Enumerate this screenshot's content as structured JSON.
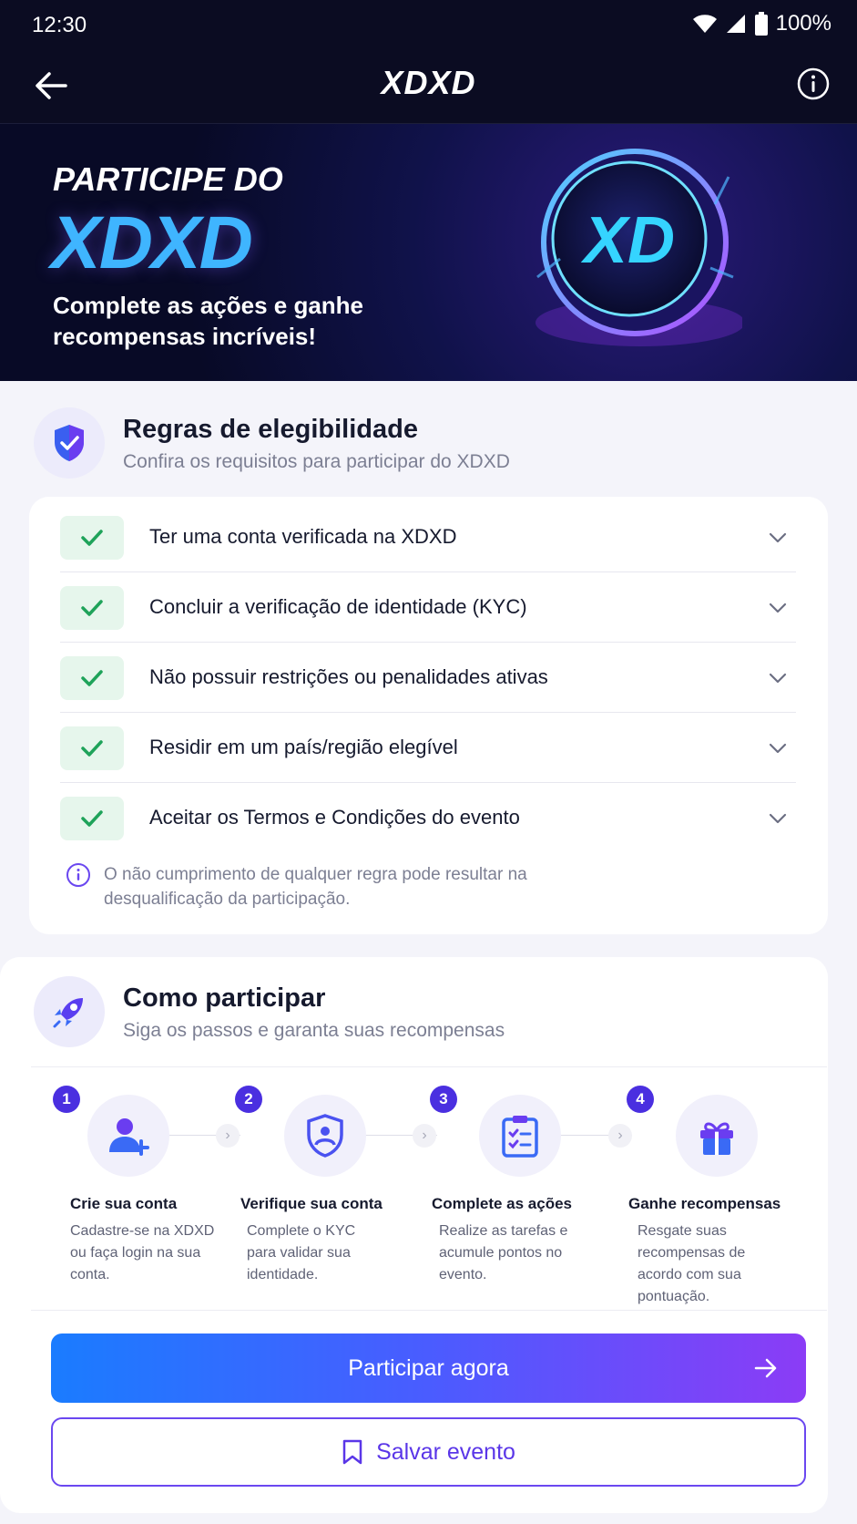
{
  "status_bar": {
    "time": "12:30",
    "battery": "100%"
  },
  "header": {
    "logo": "XDXD"
  },
  "banner": {
    "kicker": "PARTICIPE DO",
    "brand": "XDXD",
    "subtitle": "Complete as ações e ganhe recompensas incríveis!",
    "coin_label": "XD"
  },
  "eligibility": {
    "title": "Regras de elegibilidade",
    "subtitle": "Confira os requisitos para participar do XDXD",
    "rules": [
      {
        "label": "Ter uma conta verificada na XDXD"
      },
      {
        "label": "Concluir a verificação de identidade (KYC)"
      },
      {
        "label": "Não possuir restrições ou penalidades ativas"
      },
      {
        "label": "Residir em um país/região elegível"
      },
      {
        "label": "Aceitar os Termos e Condições do evento"
      }
    ],
    "note": "O não cumprimento de qualquer regra pode resultar na desqualificação da participação."
  },
  "how_to": {
    "title": "Como participar",
    "subtitle": "Siga os passos e garanta suas recompensas",
    "steps": [
      {
        "num": "1",
        "title": "Crie sua conta",
        "desc": "Cadastre-se na XDXD ou faça login na sua conta.",
        "icon": "user-add-icon"
      },
      {
        "num": "2",
        "title": "Verifique sua conta",
        "desc": "Complete o KYC para validar sua identidade.",
        "icon": "shield-user-icon"
      },
      {
        "num": "3",
        "title": "Complete as ações",
        "desc": "Realize as tarefas e acumule pontos no evento.",
        "icon": "clipboard-list-icon"
      },
      {
        "num": "4",
        "title": "Ganhe recompensas",
        "desc": "Resgate suas recompensas de acordo com sua pontuação.",
        "icon": "gift-icon"
      }
    ]
  },
  "actions": {
    "primary": "Participar agora",
    "secondary": "Salvar evento"
  },
  "colors": {
    "accent": "#5a36e8",
    "success": "#1fa35a",
    "dark_bg": "#0b0c22"
  }
}
